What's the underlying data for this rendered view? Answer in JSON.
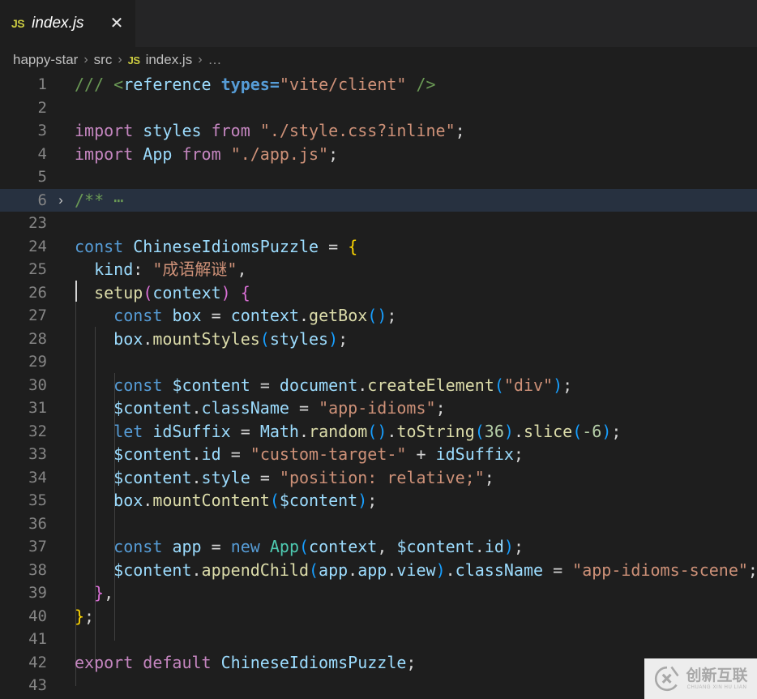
{
  "window": {
    "background": "#1e1e1e",
    "tabbar_background": "#252526"
  },
  "tabs": [
    {
      "icon": "js-file-icon",
      "icon_label": "JS",
      "label": "index.js",
      "close_label": "✕",
      "active": true
    }
  ],
  "breadcrumb": {
    "separator": "›",
    "items": [
      {
        "label": "happy-star",
        "icon": null
      },
      {
        "label": "src",
        "icon": null
      },
      {
        "label": "index.js",
        "icon": "js-file-icon",
        "icon_label": "JS"
      },
      {
        "label": "…",
        "icon": null
      }
    ]
  },
  "editor": {
    "language": "javascript",
    "cursor_line": 23,
    "fold_arrow": "›",
    "lines": [
      {
        "n": "1",
        "fold": false,
        "tokens": [
          {
            "t": "/// ",
            "c": "t-comment"
          },
          {
            "t": "<",
            "c": "t-comment"
          },
          {
            "t": "reference",
            "c": "t-tag"
          },
          {
            "t": " ",
            "c": "t-op"
          },
          {
            "t": "types",
            "c": "t-attr"
          },
          {
            "t": "=",
            "c": "t-attr"
          },
          {
            "t": "\"vite/client\"",
            "c": "t-str"
          },
          {
            "t": " ",
            "c": "t-op"
          },
          {
            "t": "/>",
            "c": "t-comment"
          }
        ]
      },
      {
        "n": "2",
        "fold": false,
        "tokens": []
      },
      {
        "n": "3",
        "fold": false,
        "tokens": [
          {
            "t": "import",
            "c": "t-kw2"
          },
          {
            "t": " ",
            "c": "t-op"
          },
          {
            "t": "styles",
            "c": "t-var"
          },
          {
            "t": " ",
            "c": "t-op"
          },
          {
            "t": "from",
            "c": "t-kw2"
          },
          {
            "t": " ",
            "c": "t-op"
          },
          {
            "t": "\"./style.css?inline\"",
            "c": "t-str"
          },
          {
            "t": ";",
            "c": "t-op"
          }
        ]
      },
      {
        "n": "4",
        "fold": false,
        "tokens": [
          {
            "t": "import",
            "c": "t-kw2"
          },
          {
            "t": " ",
            "c": "t-op"
          },
          {
            "t": "App",
            "c": "t-var"
          },
          {
            "t": " ",
            "c": "t-op"
          },
          {
            "t": "from",
            "c": "t-kw2"
          },
          {
            "t": " ",
            "c": "t-op"
          },
          {
            "t": "\"./app.js\"",
            "c": "t-str"
          },
          {
            "t": ";",
            "c": "t-op"
          }
        ]
      },
      {
        "n": "5",
        "fold": false,
        "tokens": []
      },
      {
        "n": "6",
        "fold": true,
        "tokens": [
          {
            "t": "/** ",
            "c": "t-comment"
          },
          {
            "t": "⋯",
            "c": "t-comment"
          }
        ]
      },
      {
        "n": "23",
        "fold": false,
        "tokens": []
      },
      {
        "n": "24",
        "fold": false,
        "tokens": [
          {
            "t": "const",
            "c": "t-kw"
          },
          {
            "t": " ",
            "c": "t-op"
          },
          {
            "t": "ChineseIdiomsPuzzle",
            "c": "t-var"
          },
          {
            "t": " ",
            "c": "t-op"
          },
          {
            "t": "=",
            "c": "t-op"
          },
          {
            "t": " ",
            "c": "t-op"
          },
          {
            "t": "{",
            "c": "t-p1"
          }
        ]
      },
      {
        "n": "25",
        "fold": false,
        "tokens": [
          {
            "t": "  ",
            "c": "t-op"
          },
          {
            "t": "kind",
            "c": "t-var"
          },
          {
            "t": ":",
            "c": "t-op"
          },
          {
            "t": " ",
            "c": "t-op"
          },
          {
            "t": "\"成语解谜\"",
            "c": "t-str"
          },
          {
            "t": ",",
            "c": "t-op"
          }
        ]
      },
      {
        "n": "26",
        "fold": false,
        "tokens": [
          {
            "t": "  ",
            "c": "t-op"
          },
          {
            "t": "setup",
            "c": "t-fn"
          },
          {
            "t": "(",
            "c": "t-p2"
          },
          {
            "t": "context",
            "c": "t-var"
          },
          {
            "t": ")",
            "c": "t-p2"
          },
          {
            "t": " ",
            "c": "t-op"
          },
          {
            "t": "{",
            "c": "t-p2"
          }
        ]
      },
      {
        "n": "27",
        "fold": false,
        "tokens": [
          {
            "t": "    ",
            "c": "t-op"
          },
          {
            "t": "const",
            "c": "t-kw"
          },
          {
            "t": " ",
            "c": "t-op"
          },
          {
            "t": "box",
            "c": "t-var"
          },
          {
            "t": " ",
            "c": "t-op"
          },
          {
            "t": "=",
            "c": "t-op"
          },
          {
            "t": " ",
            "c": "t-op"
          },
          {
            "t": "context",
            "c": "t-var"
          },
          {
            "t": ".",
            "c": "t-op"
          },
          {
            "t": "getBox",
            "c": "t-fn"
          },
          {
            "t": "(",
            "c": "t-p3"
          },
          {
            "t": ")",
            "c": "t-p3"
          },
          {
            "t": ";",
            "c": "t-op"
          }
        ]
      },
      {
        "n": "28",
        "fold": false,
        "tokens": [
          {
            "t": "    ",
            "c": "t-op"
          },
          {
            "t": "box",
            "c": "t-var"
          },
          {
            "t": ".",
            "c": "t-op"
          },
          {
            "t": "mountStyles",
            "c": "t-fn"
          },
          {
            "t": "(",
            "c": "t-p3"
          },
          {
            "t": "styles",
            "c": "t-var"
          },
          {
            "t": ")",
            "c": "t-p3"
          },
          {
            "t": ";",
            "c": "t-op"
          }
        ]
      },
      {
        "n": "29",
        "fold": false,
        "tokens": []
      },
      {
        "n": "30",
        "fold": false,
        "tokens": [
          {
            "t": "    ",
            "c": "t-op"
          },
          {
            "t": "const",
            "c": "t-kw"
          },
          {
            "t": " ",
            "c": "t-op"
          },
          {
            "t": "$content",
            "c": "t-var"
          },
          {
            "t": " ",
            "c": "t-op"
          },
          {
            "t": "=",
            "c": "t-op"
          },
          {
            "t": " ",
            "c": "t-op"
          },
          {
            "t": "document",
            "c": "t-var"
          },
          {
            "t": ".",
            "c": "t-op"
          },
          {
            "t": "createElement",
            "c": "t-fn"
          },
          {
            "t": "(",
            "c": "t-p3"
          },
          {
            "t": "\"div\"",
            "c": "t-str"
          },
          {
            "t": ")",
            "c": "t-p3"
          },
          {
            "t": ";",
            "c": "t-op"
          }
        ]
      },
      {
        "n": "31",
        "fold": false,
        "tokens": [
          {
            "t": "    ",
            "c": "t-op"
          },
          {
            "t": "$content",
            "c": "t-var"
          },
          {
            "t": ".",
            "c": "t-op"
          },
          {
            "t": "className",
            "c": "t-prop"
          },
          {
            "t": " ",
            "c": "t-op"
          },
          {
            "t": "=",
            "c": "t-op"
          },
          {
            "t": " ",
            "c": "t-op"
          },
          {
            "t": "\"app-idioms\"",
            "c": "t-str"
          },
          {
            "t": ";",
            "c": "t-op"
          }
        ]
      },
      {
        "n": "32",
        "fold": false,
        "tokens": [
          {
            "t": "    ",
            "c": "t-op"
          },
          {
            "t": "let",
            "c": "t-kw"
          },
          {
            "t": " ",
            "c": "t-op"
          },
          {
            "t": "idSuffix",
            "c": "t-var"
          },
          {
            "t": " ",
            "c": "t-op"
          },
          {
            "t": "=",
            "c": "t-op"
          },
          {
            "t": " ",
            "c": "t-op"
          },
          {
            "t": "Math",
            "c": "t-var"
          },
          {
            "t": ".",
            "c": "t-op"
          },
          {
            "t": "random",
            "c": "t-fn"
          },
          {
            "t": "(",
            "c": "t-p3"
          },
          {
            "t": ")",
            "c": "t-p3"
          },
          {
            "t": ".",
            "c": "t-op"
          },
          {
            "t": "toString",
            "c": "t-fn"
          },
          {
            "t": "(",
            "c": "t-p3"
          },
          {
            "t": "36",
            "c": "t-num"
          },
          {
            "t": ")",
            "c": "t-p3"
          },
          {
            "t": ".",
            "c": "t-op"
          },
          {
            "t": "slice",
            "c": "t-fn"
          },
          {
            "t": "(",
            "c": "t-p3"
          },
          {
            "t": "-6",
            "c": "t-num"
          },
          {
            "t": ")",
            "c": "t-p3"
          },
          {
            "t": ";",
            "c": "t-op"
          }
        ]
      },
      {
        "n": "33",
        "fold": false,
        "tokens": [
          {
            "t": "    ",
            "c": "t-op"
          },
          {
            "t": "$content",
            "c": "t-var"
          },
          {
            "t": ".",
            "c": "t-op"
          },
          {
            "t": "id",
            "c": "t-prop"
          },
          {
            "t": " ",
            "c": "t-op"
          },
          {
            "t": "=",
            "c": "t-op"
          },
          {
            "t": " ",
            "c": "t-op"
          },
          {
            "t": "\"custom-target-\"",
            "c": "t-str"
          },
          {
            "t": " ",
            "c": "t-op"
          },
          {
            "t": "+",
            "c": "t-op"
          },
          {
            "t": " ",
            "c": "t-op"
          },
          {
            "t": "idSuffix",
            "c": "t-var"
          },
          {
            "t": ";",
            "c": "t-op"
          }
        ]
      },
      {
        "n": "34",
        "fold": false,
        "tokens": [
          {
            "t": "    ",
            "c": "t-op"
          },
          {
            "t": "$content",
            "c": "t-var"
          },
          {
            "t": ".",
            "c": "t-op"
          },
          {
            "t": "style",
            "c": "t-prop"
          },
          {
            "t": " ",
            "c": "t-op"
          },
          {
            "t": "=",
            "c": "t-op"
          },
          {
            "t": " ",
            "c": "t-op"
          },
          {
            "t": "\"position: relative;\"",
            "c": "t-str"
          },
          {
            "t": ";",
            "c": "t-op"
          }
        ]
      },
      {
        "n": "35",
        "fold": false,
        "tokens": [
          {
            "t": "    ",
            "c": "t-op"
          },
          {
            "t": "box",
            "c": "t-var"
          },
          {
            "t": ".",
            "c": "t-op"
          },
          {
            "t": "mountContent",
            "c": "t-fn"
          },
          {
            "t": "(",
            "c": "t-p3"
          },
          {
            "t": "$content",
            "c": "t-var"
          },
          {
            "t": ")",
            "c": "t-p3"
          },
          {
            "t": ";",
            "c": "t-op"
          }
        ]
      },
      {
        "n": "36",
        "fold": false,
        "tokens": []
      },
      {
        "n": "37",
        "fold": false,
        "tokens": [
          {
            "t": "    ",
            "c": "t-op"
          },
          {
            "t": "const",
            "c": "t-kw"
          },
          {
            "t": " ",
            "c": "t-op"
          },
          {
            "t": "app",
            "c": "t-var"
          },
          {
            "t": " ",
            "c": "t-op"
          },
          {
            "t": "=",
            "c": "t-op"
          },
          {
            "t": " ",
            "c": "t-op"
          },
          {
            "t": "new",
            "c": "t-kw"
          },
          {
            "t": " ",
            "c": "t-op"
          },
          {
            "t": "App",
            "c": "t-cls"
          },
          {
            "t": "(",
            "c": "t-p3"
          },
          {
            "t": "context",
            "c": "t-var"
          },
          {
            "t": ",",
            "c": "t-op"
          },
          {
            "t": " ",
            "c": "t-op"
          },
          {
            "t": "$content",
            "c": "t-var"
          },
          {
            "t": ".",
            "c": "t-op"
          },
          {
            "t": "id",
            "c": "t-prop"
          },
          {
            "t": ")",
            "c": "t-p3"
          },
          {
            "t": ";",
            "c": "t-op"
          }
        ]
      },
      {
        "n": "38",
        "fold": false,
        "tokens": [
          {
            "t": "    ",
            "c": "t-op"
          },
          {
            "t": "$content",
            "c": "t-var"
          },
          {
            "t": ".",
            "c": "t-op"
          },
          {
            "t": "appendChild",
            "c": "t-fn"
          },
          {
            "t": "(",
            "c": "t-p3"
          },
          {
            "t": "app",
            "c": "t-var"
          },
          {
            "t": ".",
            "c": "t-op"
          },
          {
            "t": "app",
            "c": "t-prop"
          },
          {
            "t": ".",
            "c": "t-op"
          },
          {
            "t": "view",
            "c": "t-prop"
          },
          {
            "t": ")",
            "c": "t-p3"
          },
          {
            "t": ".",
            "c": "t-op"
          },
          {
            "t": "className",
            "c": "t-prop"
          },
          {
            "t": " ",
            "c": "t-op"
          },
          {
            "t": "=",
            "c": "t-op"
          },
          {
            "t": " ",
            "c": "t-op"
          },
          {
            "t": "\"app-idioms-scene\"",
            "c": "t-str"
          },
          {
            "t": ";",
            "c": "t-op"
          }
        ]
      },
      {
        "n": "39",
        "fold": false,
        "tokens": [
          {
            "t": "  ",
            "c": "t-op"
          },
          {
            "t": "}",
            "c": "t-p2"
          },
          {
            "t": ",",
            "c": "t-op"
          }
        ]
      },
      {
        "n": "40",
        "fold": false,
        "tokens": [
          {
            "t": "}",
            "c": "t-p1"
          },
          {
            "t": ";",
            "c": "t-op"
          }
        ]
      },
      {
        "n": "41",
        "fold": false,
        "tokens": []
      },
      {
        "n": "42",
        "fold": false,
        "tokens": [
          {
            "t": "export",
            "c": "t-kw2"
          },
          {
            "t": " ",
            "c": "t-op"
          },
          {
            "t": "default",
            "c": "t-kw2"
          },
          {
            "t": " ",
            "c": "t-op"
          },
          {
            "t": "ChineseIdiomsPuzzle",
            "c": "t-var"
          },
          {
            "t": ";",
            "c": "t-op"
          }
        ]
      },
      {
        "n": "43",
        "fold": false,
        "tokens": []
      }
    ]
  },
  "watermark": {
    "logo_letters": "CX",
    "title_cn": "创新互联",
    "title_en": "CHUANG XIN HU LIAN",
    "background": "#ededed",
    "color": "#a8a8a8"
  }
}
